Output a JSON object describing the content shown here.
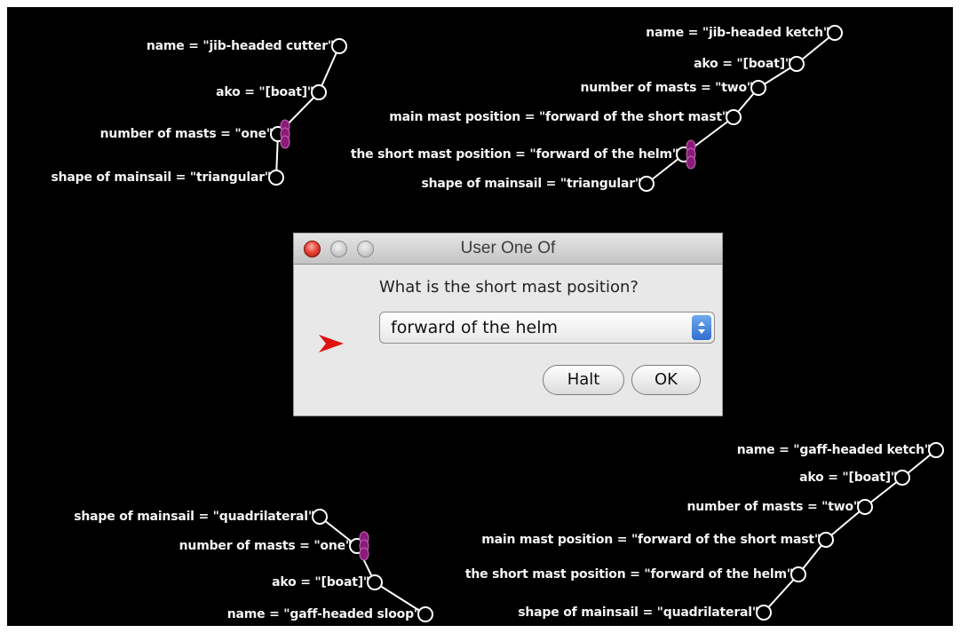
{
  "dialog": {
    "title": "User One Of",
    "question": "What is the short mast position?",
    "selected_option": "forward of the helm",
    "buttons": {
      "halt": "Halt",
      "ok": "OK"
    }
  },
  "colors": {
    "background": "#000000",
    "label_text": "#f4f4f4",
    "connector": "#ffffff",
    "highlight_node": "#8b1a7a",
    "pointer_arrow": "#e0120f",
    "select_stepper": "#3e7fdc"
  },
  "icons": {
    "node": "hollow-circle-icon",
    "highlighted_node": "magenta-bead-icon",
    "pointer": "red-arrow-icon"
  },
  "frames": [
    {
      "id": "jib-headed-cutter",
      "items": [
        "name = \"jib-headed cutter\"",
        "ako = \"[boat]\"",
        "number of masts = \"one\"",
        "shape of mainsail = \"triangular\""
      ]
    },
    {
      "id": "jib-headed-ketch",
      "items": [
        "name = \"jib-headed ketch\"",
        "ako = \"[boat]\"",
        "number of masts = \"two\"",
        "main mast position = \"forward of the short mast\"",
        "the short mast position = \"forward of the helm\"",
        "shape of mainsail = \"triangular\""
      ]
    },
    {
      "id": "gaff-headed-sloop",
      "items": [
        "shape of mainsail = \"quadrilateral\"",
        "number of masts = \"one\"",
        "ako = \"[boat]\"",
        "name = \"gaff-headed sloop\""
      ]
    },
    {
      "id": "gaff-headed-ketch",
      "items": [
        "name = \"gaff-headed ketch\"",
        "ako = \"[boat]\"",
        "number of masts = \"two\"",
        "main mast position = \"forward of the short mast\"",
        "the short mast position = \"forward of the helm\"",
        "shape of mainsail = \"quadrilateral\""
      ]
    }
  ]
}
